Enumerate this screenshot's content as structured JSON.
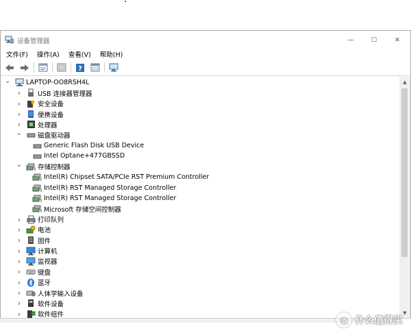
{
  "window": {
    "title": "设备管理器",
    "controls": {
      "minimize": "—",
      "maximize": "☐",
      "close": "✕"
    }
  },
  "menu": [
    {
      "name": "menu-file",
      "label": "文件(F)"
    },
    {
      "name": "menu-action",
      "label": "操作(A)"
    },
    {
      "name": "menu-view",
      "label": "查看(V)"
    },
    {
      "name": "menu-help",
      "label": "帮助(H)"
    }
  ],
  "toolbar": {
    "buttons": [
      "back-arrow-icon",
      "forward-arrow-icon",
      "properties-icon",
      "properties-sheet-icon",
      "help-icon",
      "show-hidden-icon",
      "monitor-scan-icon"
    ]
  },
  "tree": [
    {
      "label": "LAPTOP-OO8RSH4L",
      "level": 0,
      "expander": "expanded",
      "icon": "computer-icon"
    },
    {
      "label": "USB 连接器管理器",
      "level": 1,
      "expander": "collapsed",
      "icon": "usb-icon"
    },
    {
      "label": "安全设备",
      "level": 1,
      "expander": "collapsed",
      "icon": "security-device-icon"
    },
    {
      "label": "便携设备",
      "level": 1,
      "expander": "collapsed",
      "icon": "portable-device-icon"
    },
    {
      "label": "处理器",
      "level": 1,
      "expander": "collapsed",
      "icon": "processor-icon"
    },
    {
      "label": "磁盘驱动器",
      "level": 1,
      "expander": "expanded",
      "icon": "disk-drive-icon"
    },
    {
      "label": "Generic Flash Disk USB Device",
      "level": 2,
      "expander": "none",
      "icon": "disk-drive-icon"
    },
    {
      "label": "Intel Optane+477GBSSD",
      "level": 2,
      "expander": "none",
      "icon": "disk-drive-icon"
    },
    {
      "label": "存储控制器",
      "level": 1,
      "expander": "expanded",
      "icon": "storage-controller-icon"
    },
    {
      "label": "Intel(R) Chipset SATA/PCIe RST Premium Controller",
      "level": 2,
      "expander": "none",
      "icon": "storage-controller-icon"
    },
    {
      "label": "Intel(R) RST Managed Storage Controller",
      "level": 2,
      "expander": "none",
      "icon": "storage-controller-icon"
    },
    {
      "label": "Intel(R) RST Managed Storage Controller",
      "level": 2,
      "expander": "none",
      "icon": "storage-controller-icon"
    },
    {
      "label": "Microsoft 存储空间控制器",
      "level": 2,
      "expander": "none",
      "icon": "storage-controller-icon"
    },
    {
      "label": "打印队列",
      "level": 1,
      "expander": "collapsed",
      "icon": "printer-icon"
    },
    {
      "label": "电池",
      "level": 1,
      "expander": "collapsed",
      "icon": "battery-icon"
    },
    {
      "label": "固件",
      "level": 1,
      "expander": "collapsed",
      "icon": "firmware-icon"
    },
    {
      "label": "计算机",
      "level": 1,
      "expander": "collapsed",
      "icon": "computer-monitor-icon"
    },
    {
      "label": "监视器",
      "level": 1,
      "expander": "collapsed",
      "icon": "monitor-icon"
    },
    {
      "label": "键盘",
      "level": 1,
      "expander": "collapsed",
      "icon": "keyboard-icon"
    },
    {
      "label": "蓝牙",
      "level": 1,
      "expander": "collapsed",
      "icon": "bluetooth-icon"
    },
    {
      "label": "人体学输入设备",
      "level": 1,
      "expander": "collapsed",
      "icon": "hid-icon"
    },
    {
      "label": "软件设备",
      "level": 1,
      "expander": "collapsed",
      "icon": "software-device-icon"
    },
    {
      "label": "软件组件",
      "level": 1,
      "expander": "collapsed",
      "icon": "software-component-icon"
    }
  ],
  "watermark": {
    "badge": "值",
    "text": "什么值得买"
  },
  "colors": {
    "accent": "#2a6ebb",
    "bluetooth": "#1f6fd1",
    "disabled_title": "#7a7a7a"
  }
}
